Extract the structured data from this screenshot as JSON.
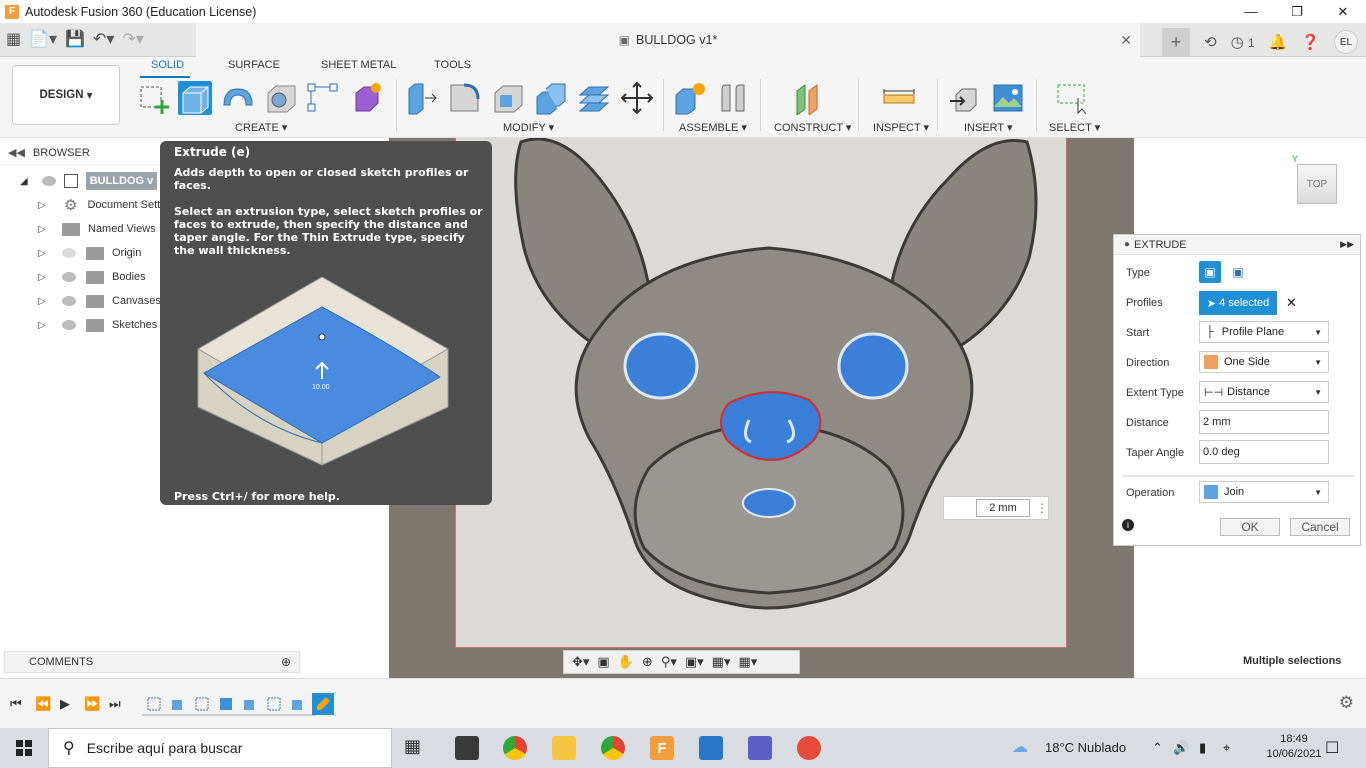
{
  "window": {
    "title": "Autodesk Fusion 360 (Education License)",
    "controls": [
      "minimize-icon",
      "restore-icon",
      "close-icon"
    ]
  },
  "appbar": {
    "doc_title": "BULLDOG v1*",
    "job_count": "1",
    "user_initials": "EL"
  },
  "toolbar": {
    "workspace": "DESIGN",
    "tabs": [
      "SOLID",
      "SURFACE",
      "SHEET METAL",
      "TOOLS"
    ],
    "active_tab": "SOLID",
    "groups": [
      "CREATE",
      "MODIFY",
      "ASSEMBLE",
      "CONSTRUCT",
      "INSPECT",
      "INSERT",
      "SELECT"
    ]
  },
  "browser": {
    "title": "BROWSER",
    "root": "BULLDOG v",
    "items": [
      "Document Sett",
      "Named Views",
      "Origin",
      "Bodies",
      "Canvases",
      "Sketches"
    ]
  },
  "comments": {
    "title": "COMMENTS"
  },
  "tooltip": {
    "title": "Extrude (e)",
    "paragraph1": "Adds depth to open or closed sketch profiles or faces.",
    "paragraph2": "Select an extrusion type, select sketch profiles or faces to extrude, then specify the distance and taper angle. For the Thin Extrude type, specify the wall thickness.",
    "illustration_value": "10.00",
    "help": "Press Ctrl+/ for more help."
  },
  "viewport": {
    "dimension_input": "2 mm",
    "viewcube_face": "TOP",
    "status": "Multiple selections"
  },
  "extrude": {
    "title": "EXTRUDE",
    "labels": {
      "type": "Type",
      "profiles": "Profiles",
      "start": "Start",
      "direction": "Direction",
      "extent_type": "Extent Type",
      "distance": "Distance",
      "taper_angle": "Taper Angle",
      "operation": "Operation"
    },
    "profiles_value": "4 selected",
    "start_value": "Profile Plane",
    "direction_value": "One Side",
    "extent_value": "Distance",
    "distance_value": "2 mm",
    "taper_value": "0.0 deg",
    "operation_value": "Join",
    "ok": "OK",
    "cancel": "Cancel"
  },
  "taskbar": {
    "search_placeholder": "Escribe aquí para buscar",
    "weather": "18°C  Nublado",
    "time": "18:49",
    "date": "10/06/2021"
  },
  "colors": {
    "accent": "#0a7ac4",
    "profile_blue": "#3b7fd8",
    "tooltip_bg": "#4f4f4f",
    "viewport_bg": "#7d7770"
  }
}
